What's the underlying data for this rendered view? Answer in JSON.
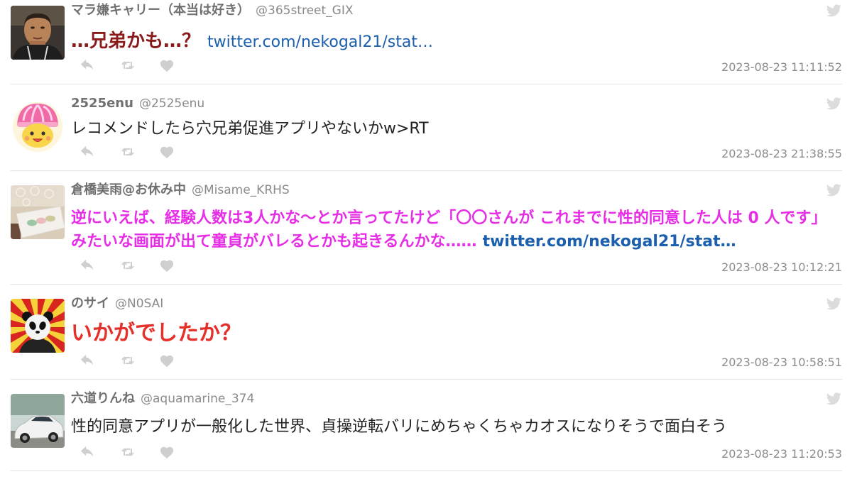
{
  "tweets": [
    {
      "user_name": "マラ嫌キャリー（本当は好き）",
      "handle": "@365street_GIX",
      "text": "…兄弟かも…？",
      "link": "twitter.com/nekogal21/stat…",
      "timestamp": "2023-08-23 11:11:52",
      "text_color": "#8b1a1a"
    },
    {
      "user_name": "2525enu",
      "handle": "@2525enu",
      "text": "レコメンドしたら穴兄弟促進アプリやないかw>RT",
      "timestamp": "2023-08-23 21:38:55",
      "text_color": "#222222"
    },
    {
      "user_name": "倉橋美雨@お休み中",
      "handle": "@Misame_KRHS",
      "text": "逆にいえば、経験人数は3人かな〜とか言ってたけど「〇〇さんが これまでに性的同意した人は 0 人です」みたいな画面が出て童貞がバレるとかも起きるんかな……",
      "link": "twitter.com/nekogal21/stat…",
      "timestamp": "2023-08-23 10:12:21",
      "text_color": "#e62ee6"
    },
    {
      "user_name": "のサイ",
      "handle": "@N0SAI",
      "text": "いかがでしたか？",
      "timestamp": "2023-08-23 10:58:51",
      "text_color": "#e5302a"
    },
    {
      "user_name": "六道りんね",
      "handle": "@aquamarine_374",
      "text": "性的同意アプリが一般化した世界、貞操逆転バリにめちゃくちゃカオスになりそうで面白そう",
      "timestamp": "2023-08-23 11:20:53",
      "text_color": "#222222"
    }
  ],
  "icons": {
    "reply": "reply-icon",
    "retweet": "retweet-icon",
    "like": "heart-icon",
    "source": "twitter-bird-icon"
  },
  "colors": {
    "link": "#1c5fad",
    "name": "#707070",
    "handle": "#8a8a8a",
    "timestamp": "#8c8c8c",
    "icon": "#cfcfcf",
    "separator": "#e3e3e3"
  }
}
